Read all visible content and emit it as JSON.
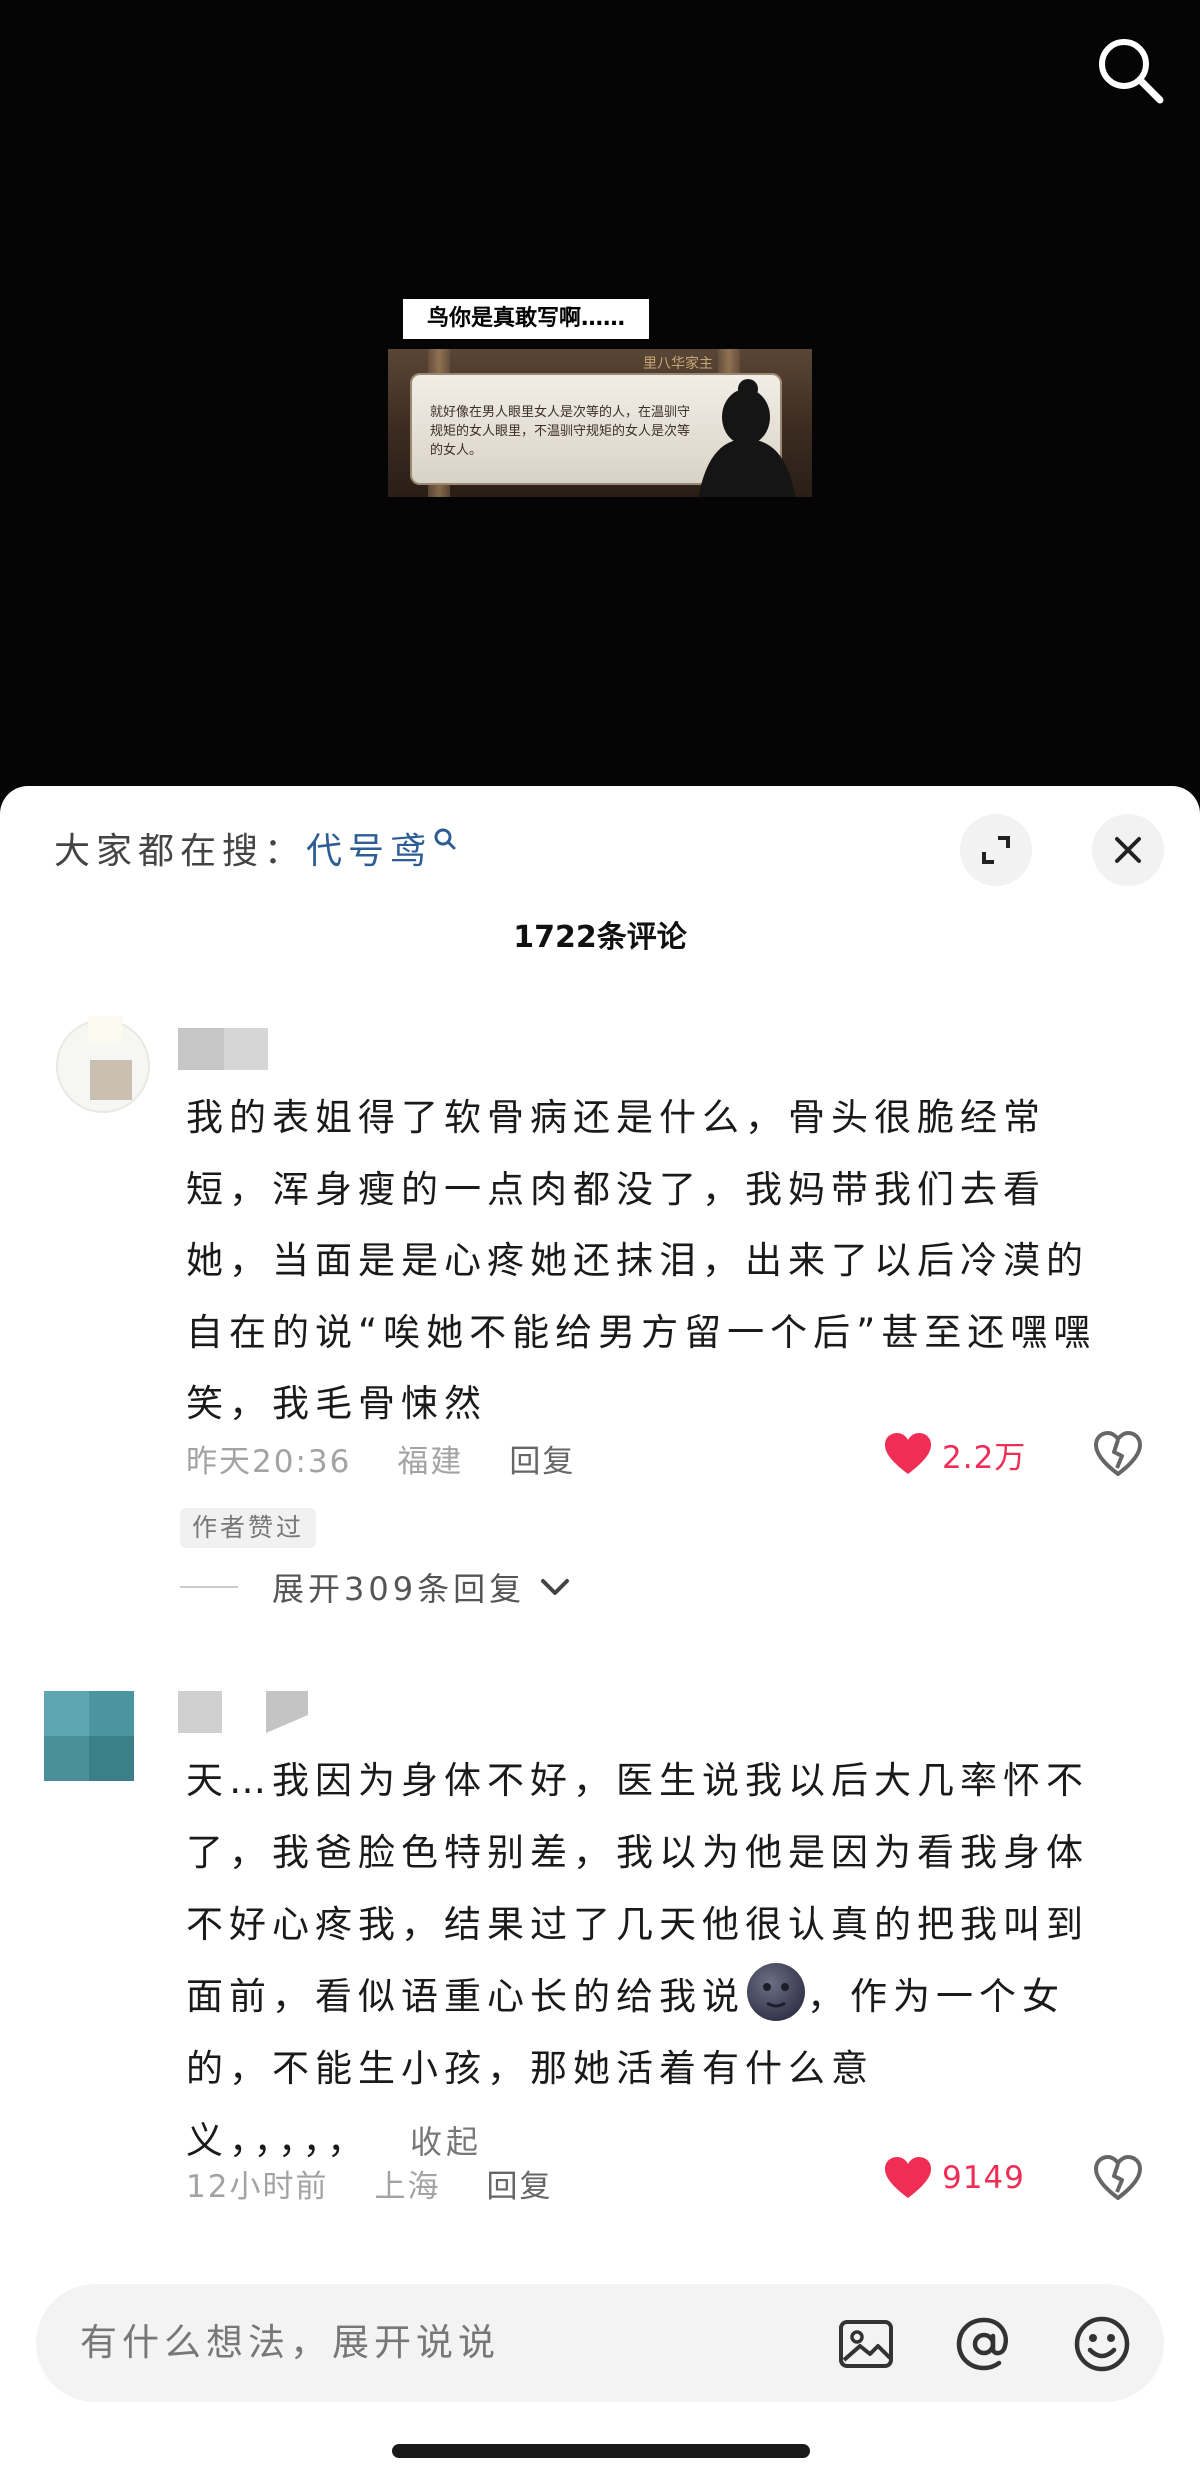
{
  "video": {
    "caption": "鸟你是真敢写啊……",
    "game_frame": {
      "speaker": "里八华家主",
      "dialogue": "就好像在男人眼里女人是次等的人，在温驯守规矩的女人眼里，不温驯守规矩的女人是次等的女人。"
    }
  },
  "panel": {
    "hot_search_prefix": "大家都在搜：",
    "hot_search_keyword": "代号鸢",
    "comment_count": "1722条评论"
  },
  "comments": [
    {
      "text": "我的表姐得了软骨病还是什么，骨头很脆经常短，浑身瘦的一点肉都没了，我妈带我们去看她，当面是是心疼她还抹泪，出来了以后冷漠的自在的说“唉她不能给男方留一个后”甚至还嘿嘿笑，我毛骨悚然",
      "time": "昨天20:36",
      "location": "福建",
      "reply_label": "回复",
      "likes": "2.2万",
      "badge": "作者赞过",
      "expand_replies": "展开309条回复"
    },
    {
      "text_before_emoji": "天…我因为身体不好，医生说我以后大几率怀不了，我爸脸色特别差，我以为他是因为看我身体不好心疼我，结果过了几天他很认真的把我叫到面前，看似语重心长的给我说",
      "text_after_emoji": "，作为一个女的，不能生小孩，那她活着有什么意",
      "text_last_line": "义，，，，，",
      "collapse_label": "收起",
      "time": "12小时前",
      "location": "上海",
      "reply_label": "回复",
      "likes": "9149"
    }
  ],
  "input_bar": {
    "placeholder": "有什么想法，展开说说"
  },
  "colors": {
    "like_red": "#ef2d55",
    "keyword_blue": "#2e5d96"
  }
}
